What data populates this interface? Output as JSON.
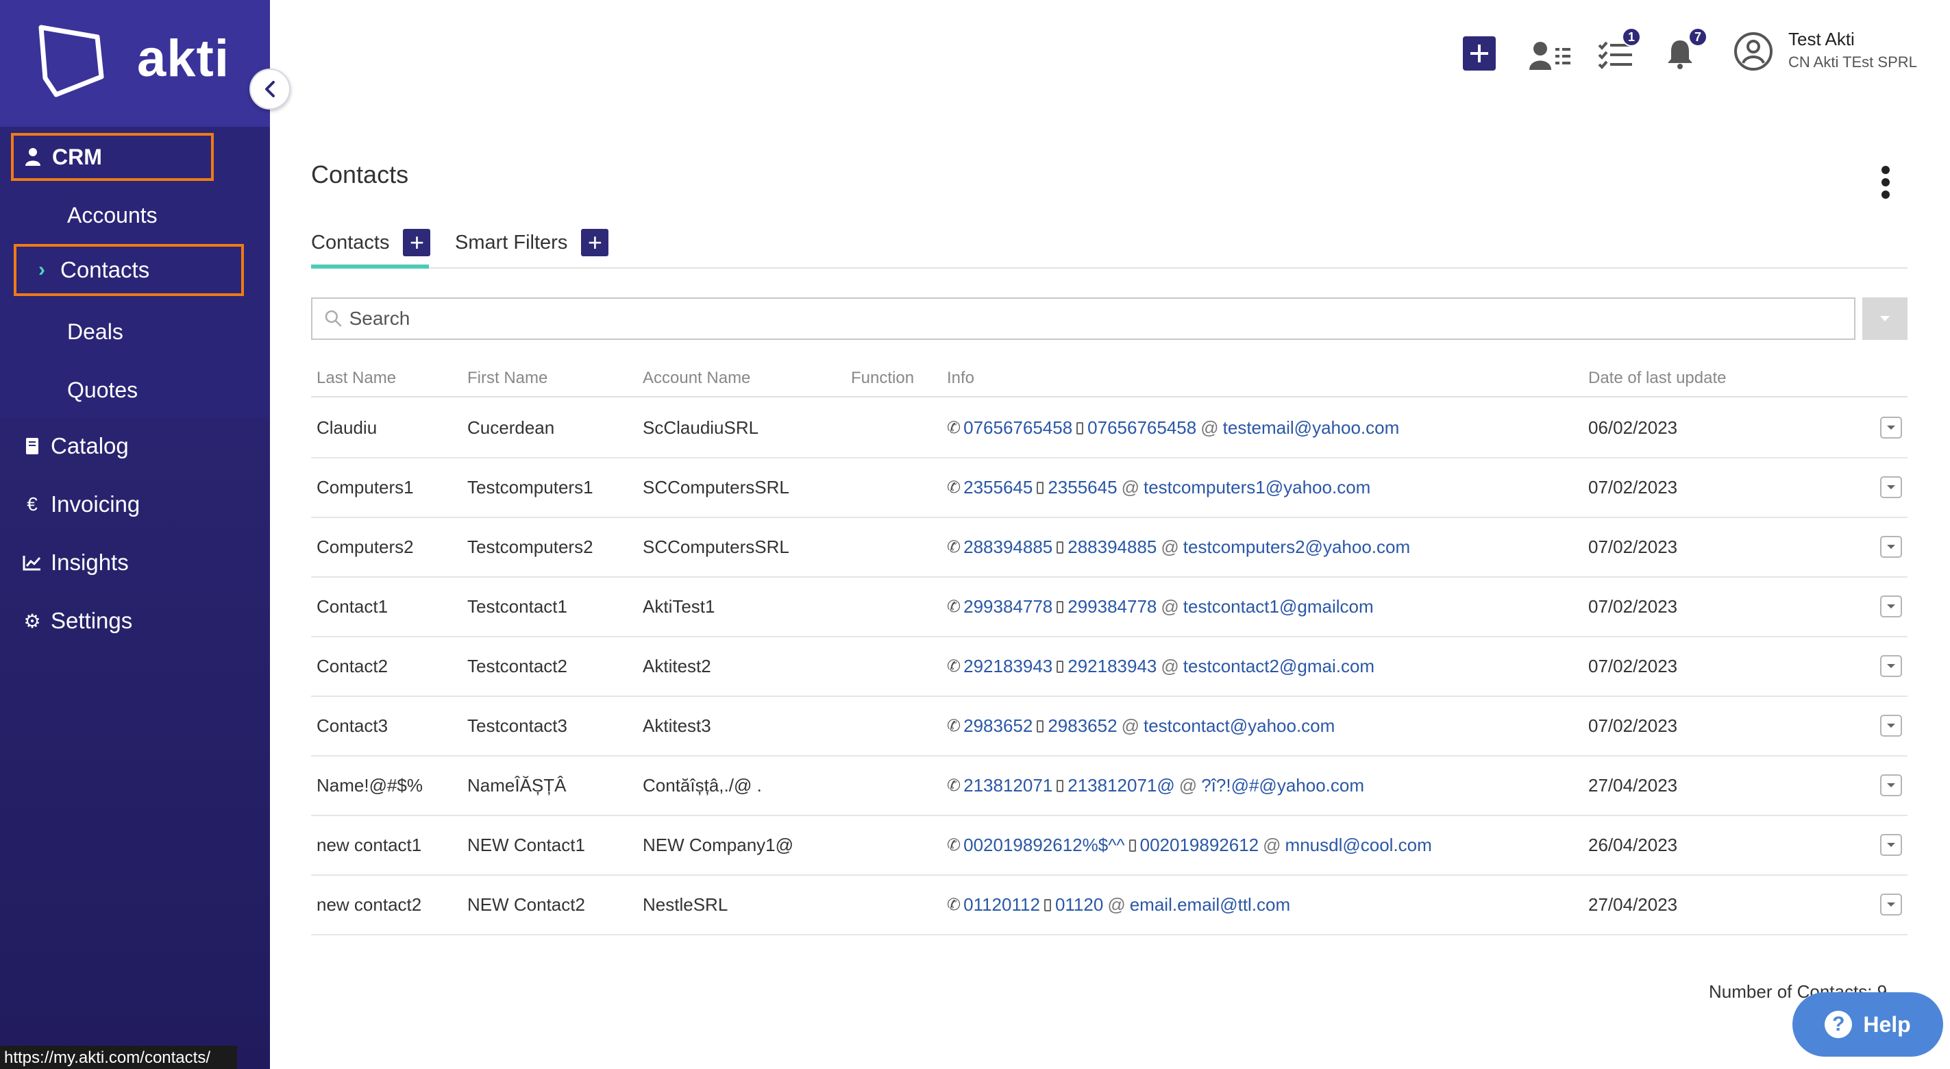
{
  "brand": {
    "name": "akti"
  },
  "sidebar": {
    "crm_label": "CRM",
    "crm_items": [
      "Accounts",
      "Contacts",
      "Deals",
      "Quotes"
    ],
    "active_item": "Contacts",
    "main_items": [
      "Catalog",
      "Invoicing",
      "Insights",
      "Settings"
    ]
  },
  "topbar": {
    "tasks_badge": "1",
    "notifications_badge": "7",
    "user_name": "Test Akti",
    "user_company": "CN Akti TEst SPRL"
  },
  "page": {
    "title": "Contacts",
    "tabs": [
      "Contacts",
      "Smart Filters"
    ],
    "active_tab": "Contacts",
    "search_placeholder": "Search"
  },
  "table": {
    "columns": [
      "Last Name",
      "First Name",
      "Account Name",
      "Function",
      "Info",
      "Date of last update"
    ],
    "rows": [
      {
        "last": "Claudiu",
        "first": "Cucerdean",
        "account": "ScClaudiuSRL",
        "function": "",
        "phone": "07656765458",
        "mobile": "07656765458",
        "email": "testemail@yahoo.com",
        "date": "06/02/2023"
      },
      {
        "last": "Computers1",
        "first": "Testcomputers1",
        "account": "SCComputersSRL",
        "function": "",
        "phone": "2355645",
        "mobile": "2355645",
        "email": "testcomputers1@yahoo.com",
        "date": "07/02/2023"
      },
      {
        "last": "Computers2",
        "first": "Testcomputers2",
        "account": "SCComputersSRL",
        "function": "",
        "phone": "288394885",
        "mobile": "288394885",
        "email": "testcomputers2@yahoo.com",
        "date": "07/02/2023"
      },
      {
        "last": "Contact1",
        "first": "Testcontact1",
        "account": "AktiTest1",
        "function": "",
        "phone": "299384778",
        "mobile": "299384778",
        "email": "testcontact1@gmailcom",
        "date": "07/02/2023"
      },
      {
        "last": "Contact2",
        "first": "Testcontact2",
        "account": "Aktitest2",
        "function": "",
        "phone": "292183943",
        "mobile": "292183943",
        "email": "testcontact2@gmai.com",
        "date": "07/02/2023"
      },
      {
        "last": "Contact3",
        "first": "Testcontact3",
        "account": "Aktitest3",
        "function": "",
        "phone": "2983652",
        "mobile": "2983652",
        "email": "testcontact@yahoo.com",
        "date": "07/02/2023"
      },
      {
        "last": "Name!@#$%",
        "first": "NameÎĂȘȚÂ",
        "account": "Contăîșțâ,./@ .",
        "function": "",
        "phone": "213812071",
        "mobile": "213812071@",
        "email": "?î?!@#@yahoo.com",
        "date": "27/04/2023"
      },
      {
        "last": "new contact1",
        "first": "NEW Contact1",
        "account": "NEW Company1@",
        "function": "",
        "phone": "002019892612%$^^",
        "mobile": "002019892612",
        "email": "mnusdl@cool.com",
        "date": "26/04/2023"
      },
      {
        "last": "new contact2",
        "first": "NEW Contact2",
        "account": "NestleSRL",
        "function": "",
        "phone": "01120112",
        "mobile": "01120",
        "email": "email.email@ttl.com",
        "date": "27/04/2023"
      }
    ]
  },
  "footer": {
    "count_text": "Number of Contacts: 9"
  },
  "help": {
    "label": "Help"
  },
  "status_url": "https://my.akti.com/contacts/",
  "colors": {
    "sidebar": "#2b2577",
    "accent": "#2e2a78",
    "highlight": "#f07a16",
    "tab_underline": "#4fcab4",
    "link": "#2a57a6",
    "help": "#4d86d8"
  }
}
